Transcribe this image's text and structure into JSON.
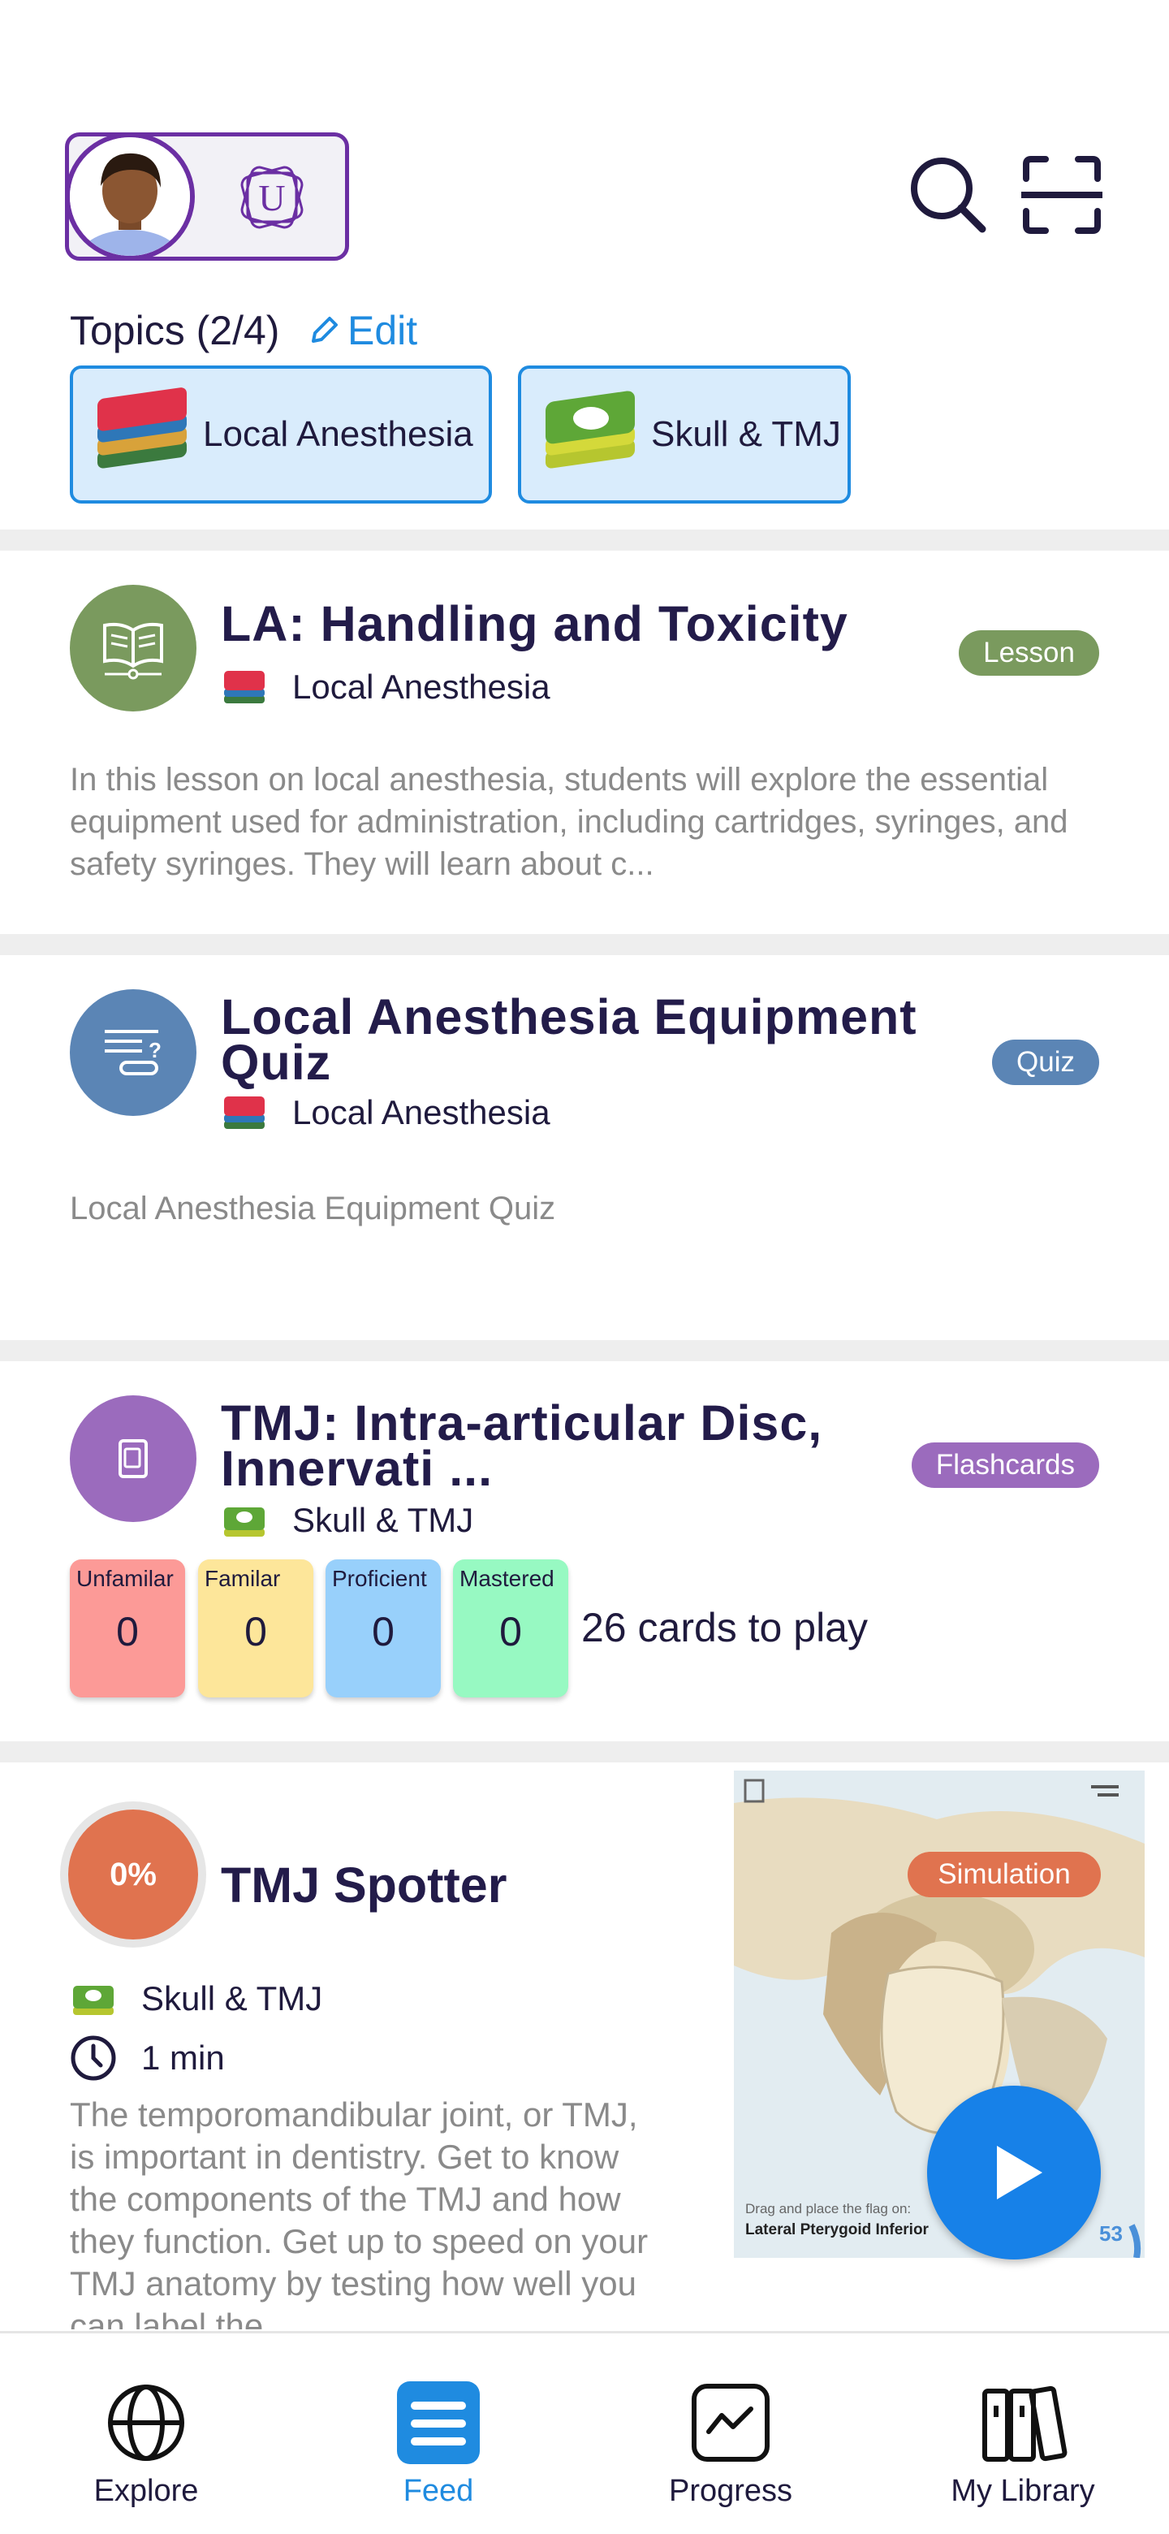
{
  "header": {
    "org_logo_letter": "U",
    "topics_label": "Topics (2/4)",
    "edit_label": "Edit",
    "topics": [
      {
        "name": "Local Anesthesia"
      },
      {
        "name": "Skull & TMJ"
      }
    ]
  },
  "feed": {
    "lesson": {
      "title": "LA: Handling and Toxicity",
      "topic": "Local Anesthesia",
      "badge": "Lesson",
      "badge_color": "#7a9a5e",
      "description": "In this lesson on local anesthesia, students will explore the essential equipment used for administration, including cartridges, syringes, and safety syringes. They will learn about c..."
    },
    "quiz": {
      "title_line1": "Local Anesthesia Equipment",
      "title_line2": "Quiz",
      "topic": "Local Anesthesia",
      "badge": "Quiz",
      "badge_color": "#5b85b5",
      "description": "Local Anesthesia Equipment Quiz"
    },
    "flashcards": {
      "title_line1": "TMJ: Intra-articular Disc,",
      "title_line2": "Innervati ...",
      "topic": "Skull & TMJ",
      "badge": "Flashcards",
      "badge_color": "#9b6bbd",
      "mastery": [
        {
          "label": "Unfamilar",
          "value": "0",
          "color": "#fc9a97"
        },
        {
          "label": "Familar",
          "value": "0",
          "color": "#fde69a"
        },
        {
          "label": "Proficient",
          "value": "0",
          "color": "#98d0fb"
        },
        {
          "label": "Mastered",
          "value": "0",
          "color": "#97f9c2"
        }
      ],
      "cards_to_play": "26 cards to play"
    },
    "simulation": {
      "progress": "0%",
      "title": "TMJ Spotter",
      "topic": "Skull & TMJ",
      "duration": "1 min",
      "badge": "Simulation",
      "badge_color": "#e0734f",
      "description": "The temporomandibular joint, or TMJ, is important in dentistry.  Get to know the components of the TMJ and how they function.  Get up to speed on your TMJ anatomy by testing how well you can label the",
      "thumbnail_caption": "Drag and place the flag on:",
      "thumbnail_caption2": "Lateral Pterygoid Inferior",
      "thumbnail_counter": "53"
    }
  },
  "nav": {
    "items": [
      {
        "label": "Explore",
        "icon": "globe-icon"
      },
      {
        "label": "Feed",
        "icon": "feed-icon",
        "active": true
      },
      {
        "label": "Progress",
        "icon": "progress-chart-icon"
      },
      {
        "label": "My Library",
        "icon": "library-icon"
      }
    ]
  },
  "colors": {
    "accent": "#1f8be0",
    "brand_purple": "#6b2fa3",
    "title_text": "#231c4a"
  }
}
